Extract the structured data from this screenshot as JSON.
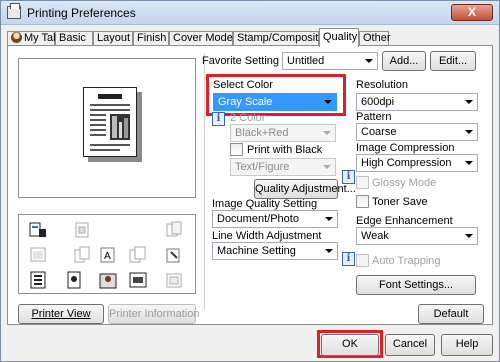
{
  "window": {
    "title": "Printing Preferences",
    "close_label": "X"
  },
  "tabs": [
    {
      "label": "My Tab"
    },
    {
      "label": "Basic"
    },
    {
      "label": "Layout"
    },
    {
      "label": "Finish"
    },
    {
      "label": "Cover Mode"
    },
    {
      "label": "Stamp/Composition"
    },
    {
      "label": "Quality",
      "active": true
    },
    {
      "label": "Other"
    }
  ],
  "favorite": {
    "label": "Favorite Setting",
    "value": "Untitled",
    "add_label": "Add...",
    "edit_label": "Edit..."
  },
  "left": {
    "printer_view_label": "Printer View",
    "printer_info_label": "Printer Information"
  },
  "select_color": {
    "label": "Select Color",
    "value": "Gray Scale"
  },
  "two_color": {
    "label": "2 Color",
    "value": "Black+Red"
  },
  "print_with_black": {
    "label": "Print with Black",
    "value": "Text/Figure"
  },
  "quality_adjustment_label": "Quality Adjustment...",
  "image_quality": {
    "label": "Image Quality Setting",
    "value": "Document/Photo"
  },
  "line_width": {
    "label": "Line Width Adjustment",
    "value": "Machine Setting"
  },
  "resolution": {
    "label": "Resolution",
    "value": "600dpi"
  },
  "pattern": {
    "label": "Pattern",
    "value": "Coarse"
  },
  "image_compression": {
    "label": "Image Compression",
    "value": "High Compression"
  },
  "glossy_mode_label": "Glossy Mode",
  "toner_save_label": "Toner Save",
  "edge_enhancement": {
    "label": "Edge Enhancement",
    "value": "Weak"
  },
  "auto_trapping_label": "Auto Trapping",
  "font_settings_label": "Font Settings...",
  "default_label": "Default",
  "footer": {
    "ok_label": "OK",
    "cancel_label": "Cancel",
    "help_label": "Help"
  },
  "colors": {
    "highlight": "#3399ff",
    "annotation_red": "#e11d2a",
    "info_blue": "#2d5cb3"
  }
}
